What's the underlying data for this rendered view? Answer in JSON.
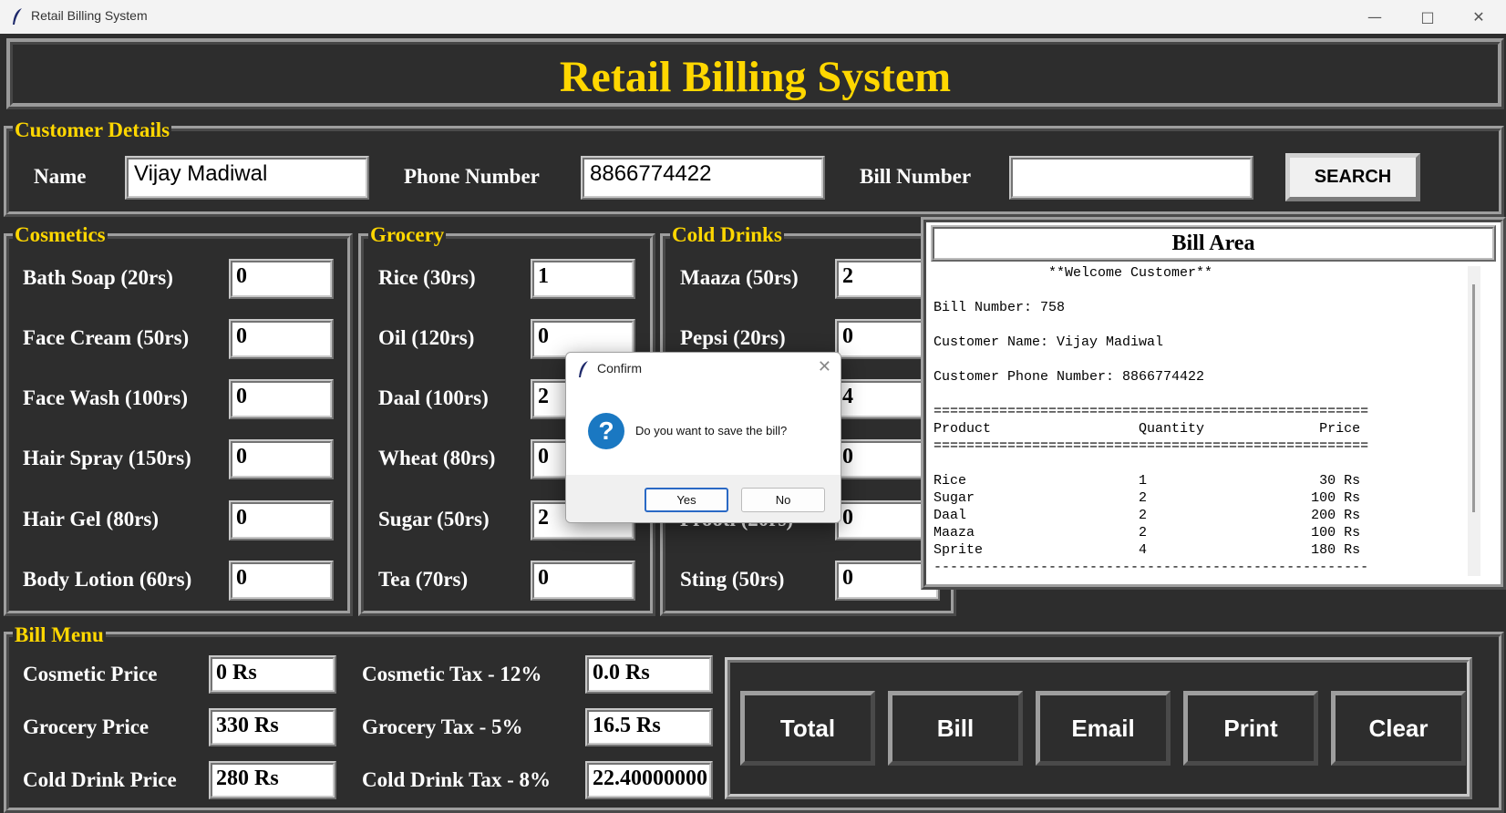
{
  "window": {
    "title": "Retail Billing System"
  },
  "header": {
    "title": "Retail Billing System"
  },
  "customer": {
    "legend": "Customer Details",
    "name_label": "Name",
    "name_value": "Vijay Madiwal",
    "phone_label": "Phone Number",
    "phone_value": "8866774422",
    "bill_label": "Bill Number",
    "bill_value": "",
    "search_label": "SEARCH"
  },
  "cosmetics": {
    "legend": "Cosmetics",
    "items": [
      {
        "label": "Bath Soap (20rs)",
        "value": "0"
      },
      {
        "label": "Face Cream (50rs)",
        "value": "0"
      },
      {
        "label": "Face Wash (100rs)",
        "value": "0"
      },
      {
        "label": "Hair Spray (150rs)",
        "value": "0"
      },
      {
        "label": "Hair Gel (80rs)",
        "value": "0"
      },
      {
        "label": "Body Lotion (60rs)",
        "value": "0"
      }
    ]
  },
  "grocery": {
    "legend": "Grocery",
    "items": [
      {
        "label": "Rice (30rs)",
        "value": "1"
      },
      {
        "label": "Oil (120rs)",
        "value": "0"
      },
      {
        "label": "Daal (100rs)",
        "value": "2"
      },
      {
        "label": "Wheat (80rs)",
        "value": "0"
      },
      {
        "label": "Sugar (50rs)",
        "value": "2"
      },
      {
        "label": "Tea (70rs)",
        "value": "0"
      }
    ]
  },
  "colddrinks": {
    "legend": "Cold Drinks",
    "items": [
      {
        "label": "Maaza (50rs)",
        "value": "2"
      },
      {
        "label": "Pepsi (20rs)",
        "value": "0"
      },
      {
        "label": "",
        "value": "4"
      },
      {
        "label": "",
        "value": "0"
      },
      {
        "label": "Frooti (20rs)",
        "value": "0"
      },
      {
        "label": "Sting (50rs)",
        "value": "0"
      }
    ]
  },
  "billarea": {
    "title": "Bill Area",
    "text": "              **Welcome Customer**\n\nBill Number: 758\n\nCustomer Name: Vijay Madiwal\n\nCustomer Phone Number: 8866774422\n\n=====================================================\nProduct                  Quantity              Price\n=====================================================\n\nRice                     1                     30 Rs\nSugar                    2                    100 Rs\nDaal                     2                    200 Rs\nMaaza                    2                    100 Rs\nSprite                   4                    180 Rs\n-----------------------------------------------------"
  },
  "billmenu": {
    "legend": "Bill Menu",
    "cosmetic_price_label": "Cosmetic Price",
    "cosmetic_price": "0 Rs",
    "grocery_price_label": "Grocery Price",
    "grocery_price": "330 Rs",
    "colddrink_price_label": "Cold Drink Price",
    "colddrink_price": "280 Rs",
    "cosmetic_tax_label": "Cosmetic Tax - 12%",
    "cosmetic_tax": "0.0 Rs",
    "grocery_tax_label": "Grocery Tax - 5%",
    "grocery_tax": "16.5 Rs",
    "colddrink_tax_label": "Cold Drink Tax - 8%",
    "colddrink_tax": "22.40000000",
    "buttons": {
      "total": "Total",
      "bill": "Bill",
      "email": "Email",
      "print": "Print",
      "clear": "Clear"
    }
  },
  "dialog": {
    "title": "Confirm",
    "message": "Do you want to save the bill?",
    "yes": "Yes",
    "no": "No"
  }
}
